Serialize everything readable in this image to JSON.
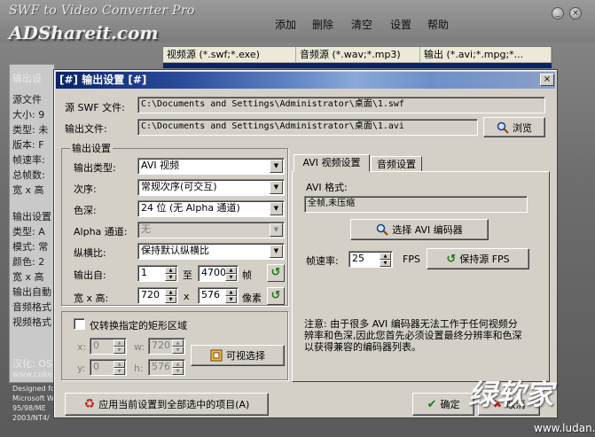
{
  "app": {
    "title": "SWF to Video Converter Pro",
    "brand": "ADShareit.com",
    "menu": [
      "添加",
      "删除",
      "清空",
      "设置",
      "帮助"
    ],
    "window_buttons": [
      "_",
      "×"
    ],
    "table_headers": [
      "视频源 (*.swf;*.exe)",
      "音频源 (*.wav;*.mp3)",
      "输出 (*.avi;*.mpg;*..."
    ],
    "left_panel": [
      "输出设",
      "源文件",
      "大小: 9",
      "类型: 未",
      "版本: F",
      "帧速率:",
      "总帧数:",
      "宽 x 高",
      "输出设置",
      "类型: A",
      "模式: 常",
      "颜色: 2",
      "宽 x 高",
      "输出自動",
      "音频格式",
      "视频格式",
      "汉化: OS",
      "www.coke",
      "Designed fo",
      "Microsoft W",
      "95/98/ME",
      "2003/NT4/"
    ]
  },
  "dialog": {
    "title": "[#] 输出设置 [#]",
    "close": "×",
    "source_label": "源 SWF 文件:",
    "source_value": "C:\\Documents and Settings\\Administrator\\桌面\\1.swf",
    "output_label": "输出文件:",
    "output_value": "C:\\Documents and Settings\\Administrator\\桌面\\1.avi",
    "browse_label": "浏览",
    "output_group_title": "输出设置",
    "rows": {
      "output_type": {
        "label": "输出类型:",
        "value": "AVI 视频"
      },
      "order": {
        "label": "次序:",
        "value": "常规次序(可交互)"
      },
      "color_depth": {
        "label": "色深:",
        "value": "24 位 (无 Alpha 通道)"
      },
      "alpha": {
        "label": "Alpha 通道:",
        "value": "无"
      },
      "aspect": {
        "label": "纵横比:",
        "value": "保持默认纵横比"
      },
      "output_from": {
        "label": "输出自:",
        "from": "1",
        "to_label": "至",
        "to": "4700",
        "unit": "帧"
      },
      "size": {
        "label": "宽 x 高:",
        "width": "720",
        "x_label": "x",
        "height": "576",
        "unit": "像素"
      }
    },
    "region": {
      "checkbox_label": "仅转换指定的矩形区域",
      "x_label": "x:",
      "x": "0",
      "w_label": "w:",
      "w": "720",
      "y_label": "y:",
      "y": "0",
      "h_label": "h:",
      "h": "576",
      "visual_label": "可视选择"
    },
    "tabs": [
      "AVI 视频设置",
      "音频设置"
    ],
    "avi": {
      "format_label": "AVI 格式:",
      "format_value": "全帧,未压缩",
      "choose_encoder": "选择 AVI 编码器",
      "fps_label": "帧速率:",
      "fps_value": "25",
      "fps_unit": "FPS",
      "keep_fps": "保持源 FPS",
      "note": "注意: 由于很多 AVI 编码器无法工作于任何视频分辨率和色深,因此您首先必须设置最终分辨率和色深以获得兼容的编码器列表。"
    },
    "apply_all": "应用当前设置到全部选中的项目(A)",
    "ok": "确定",
    "cancel": "取消"
  },
  "watermark": {
    "text": "绿软家",
    "url": "www.ludan.cn"
  }
}
